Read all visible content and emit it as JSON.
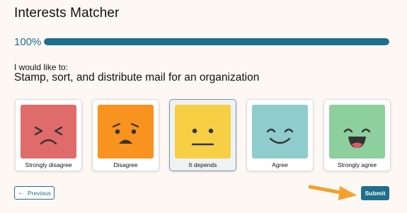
{
  "header": {
    "title": "Interests Matcher"
  },
  "progress": {
    "label": "100%",
    "value": 1.0,
    "color": "#1f6e8c"
  },
  "question": {
    "prompt": "I would like to:",
    "text": "Stamp, sort, and distribute mail for an organization"
  },
  "options": [
    {
      "label": "Strongly disagree",
      "face": "very-sad-face-icon",
      "color": "#e06b6b",
      "selected": false
    },
    {
      "label": "Disagree",
      "face": "worried-face-icon",
      "color": "#f7931e",
      "selected": false
    },
    {
      "label": "It depends",
      "face": "neutral-face-icon",
      "color": "#f7cf45",
      "selected": true
    },
    {
      "label": "Agree",
      "face": "smile-face-icon",
      "color": "#8fcccc",
      "selected": false
    },
    {
      "label": "Strongly agree",
      "face": "laughing-face-icon",
      "color": "#8dcf9d",
      "selected": false
    }
  ],
  "nav": {
    "previous_label": "Previous",
    "previous_icon": "arrow-left-icon",
    "submit_label": "Submit",
    "pointer_icon": "arrow-right-icon",
    "pointer_color": "#f2a12c"
  }
}
